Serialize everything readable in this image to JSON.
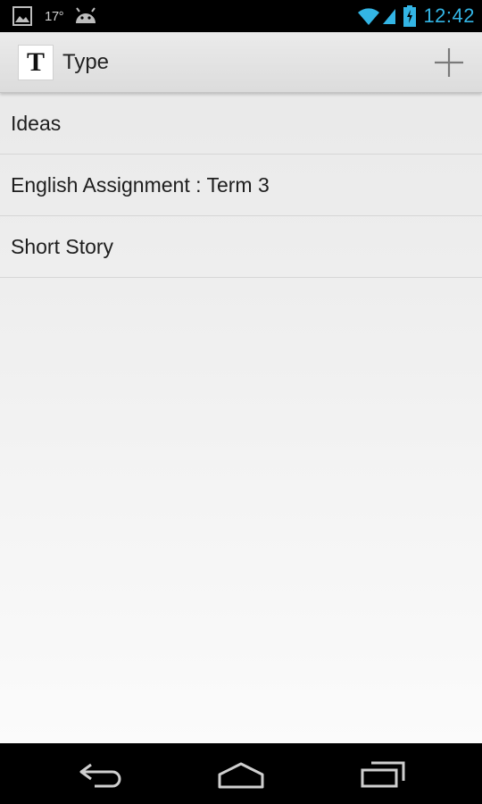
{
  "status_bar": {
    "temperature": "17°",
    "time": "12:42",
    "time_color": "#33b5e5",
    "icons": [
      "image-notification-icon",
      "android-icon",
      "wifi-icon",
      "signal-icon",
      "battery-charging-icon"
    ]
  },
  "action_bar": {
    "app_icon_letter": "T",
    "title": "Type",
    "add_icon": "plus-icon"
  },
  "documents": [
    {
      "title": "Ideas"
    },
    {
      "title": "English Assignment : Term 3"
    },
    {
      "title": "Short Story"
    }
  ],
  "nav_bar": {
    "icons": [
      "back-icon",
      "home-icon",
      "recent-apps-icon"
    ]
  }
}
